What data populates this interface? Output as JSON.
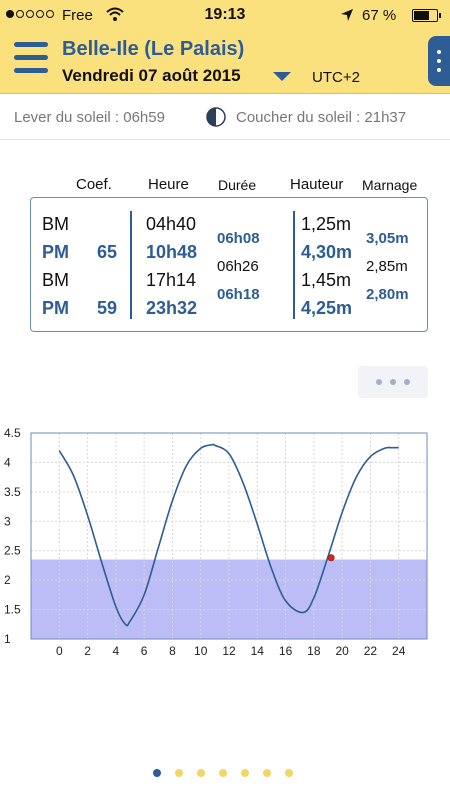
{
  "status_bar": {
    "carrier": "Free",
    "time": "19:13",
    "battery_text": "67 %",
    "battery_level": 0.67,
    "signal_bars": 1
  },
  "header": {
    "title": "Belle-Ile (Le Palais)",
    "date": "Vendredi 07 août 2015",
    "timezone": "UTC+2"
  },
  "sun": {
    "sunrise": "Lever du soleil : 06h59",
    "sunset": "Coucher du soleil : 21h37"
  },
  "table": {
    "headers": {
      "coef": "Coef.",
      "time": "Heure",
      "duration": "Durée",
      "height": "Hauteur",
      "range": "Marnage"
    },
    "rows": [
      {
        "type": "BM",
        "coef": "",
        "time": "04h40",
        "height": "1,25m"
      },
      {
        "type": "PM",
        "coef": "65",
        "time": "10h48",
        "height": "4,30m"
      },
      {
        "type": "BM",
        "coef": "",
        "time": "17h14",
        "height": "1,45m"
      },
      {
        "type": "PM",
        "coef": "59",
        "time": "23h32",
        "height": "4,25m"
      }
    ],
    "durations": [
      "06h08",
      "06h26",
      "06h18"
    ],
    "ranges": [
      "3,05m",
      "2,85m",
      "2,80m"
    ]
  },
  "chart_data": {
    "type": "line",
    "x": [
      0,
      1,
      2,
      3,
      4,
      4.67,
      5,
      6,
      7,
      8,
      9,
      10,
      10.8,
      11,
      12,
      13,
      14,
      15,
      16,
      17.23,
      18,
      19,
      20,
      21,
      22,
      23,
      23.53,
      24
    ],
    "y": [
      4.2,
      3.78,
      3.1,
      2.3,
      1.55,
      1.25,
      1.3,
      1.75,
      2.55,
      3.35,
      3.95,
      4.24,
      4.3,
      4.29,
      4.15,
      3.65,
      2.95,
      2.2,
      1.65,
      1.45,
      1.7,
      2.4,
      3.15,
      3.75,
      4.1,
      4.24,
      4.25,
      4.25
    ],
    "current_point": {
      "x": 19.22,
      "y": 2.38
    },
    "shaded_below": 2.35,
    "xlim": [
      -2,
      26
    ],
    "ylim": [
      1,
      4.5
    ],
    "xticks": [
      0,
      2,
      4,
      6,
      8,
      10,
      12,
      14,
      16,
      18,
      20,
      22,
      24
    ],
    "yticks": [
      1,
      1.5,
      2,
      2.5,
      3,
      3.5,
      4,
      4.5
    ],
    "xtick_labels": [
      "0",
      "2",
      "4",
      "6",
      "8",
      "10",
      "12",
      "14",
      "16",
      "18",
      "20",
      "22",
      "24"
    ],
    "ytick_labels": [
      "1",
      "1.5",
      "2",
      "2.5",
      "3",
      "3.5",
      "4",
      "4.5"
    ],
    "grid": true,
    "colors": {
      "line": "#2d5d94",
      "shade": "#bcbdf6",
      "point": "#d9261c"
    }
  },
  "pagination": {
    "count": 7,
    "active": 0
  },
  "colors": {
    "accent": "#2d5d94",
    "header_bg": "#fbe07e"
  }
}
